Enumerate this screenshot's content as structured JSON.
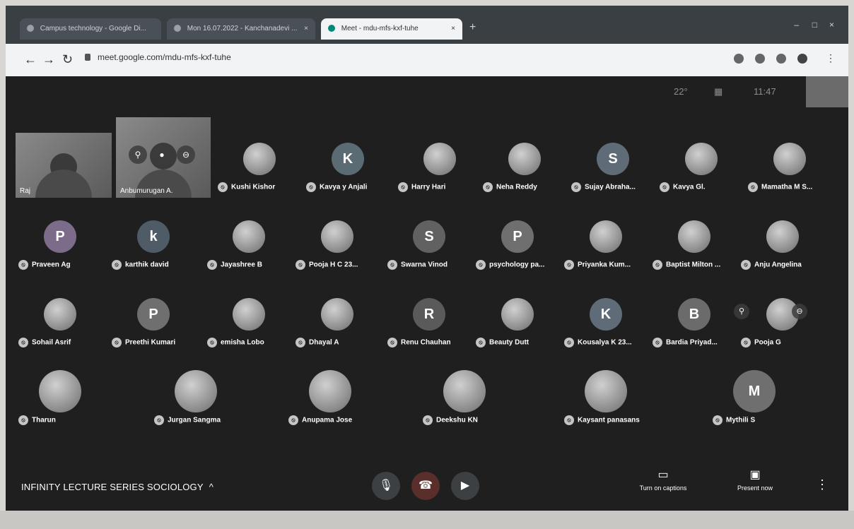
{
  "browser": {
    "tabs": [
      {
        "label": "Campus technology - Google Di...",
        "active": false
      },
      {
        "label": "Mon 16.07.2022 - Kanchanadevi ...",
        "active": false
      },
      {
        "label": "Meet - mdu-mfs-kxf-tuhe",
        "active": true
      }
    ],
    "url": "meet.google.com/mdu-mfs-kxf-tuhe",
    "new_tab": "+"
  },
  "meet": {
    "top_status": {
      "temp": "22°",
      "people_icon": "people-icon",
      "time": "11:47"
    },
    "video_tiles": [
      {
        "name": "Raj",
        "color": "#6e6e6e"
      },
      {
        "name": "Anbumurugan A.",
        "color": "#5b5b5b"
      }
    ],
    "participants": [
      {
        "name": "Kushi Kishor",
        "avatar": "photo",
        "initial": "",
        "color": "#888"
      },
      {
        "name": "Kavya y Anjali",
        "avatar": "letter",
        "initial": "K",
        "color": "#5b6b73"
      },
      {
        "name": "Harry Hari",
        "avatar": "photo",
        "initial": "",
        "color": "#777"
      },
      {
        "name": "Neha Reddy",
        "avatar": "photo",
        "initial": "",
        "color": "#888"
      },
      {
        "name": "Sujay Abraha...",
        "avatar": "letter",
        "initial": "S",
        "color": "#5f6c77"
      },
      {
        "name": "Kavya Gl.",
        "avatar": "photo",
        "initial": "",
        "color": "#888"
      },
      {
        "name": "Mamatha M S...",
        "avatar": "photo",
        "initial": "",
        "color": "#777"
      },
      {
        "name": "Praveen Ag",
        "avatar": "letter",
        "initial": "P",
        "color": "#7d6b8a"
      },
      {
        "name": "karthik david",
        "avatar": "letter",
        "initial": "k",
        "color": "#4f5b66"
      },
      {
        "name": "Jayashree B",
        "avatar": "photo",
        "initial": "",
        "color": "#777"
      },
      {
        "name": "Pooja H C 23...",
        "avatar": "photo",
        "initial": "",
        "color": "#888"
      },
      {
        "name": "Swarna Vinod",
        "avatar": "letter",
        "initial": "S",
        "color": "#616161"
      },
      {
        "name": "psychology pa...",
        "avatar": "letter",
        "initial": "P",
        "color": "#6f6f6f"
      },
      {
        "name": "Priyanka Kum...",
        "avatar": "photo",
        "initial": "",
        "color": "#777"
      },
      {
        "name": "Baptist Milton ...",
        "avatar": "photo",
        "initial": "",
        "color": "#888"
      },
      {
        "name": "Anju Angelina",
        "avatar": "photo",
        "initial": "",
        "color": "#777"
      },
      {
        "name": "Sohail Asrif",
        "avatar": "photo",
        "initial": "",
        "color": "#888"
      },
      {
        "name": "Preethi Kumari",
        "avatar": "letter",
        "initial": "P",
        "color": "#6f6f6f"
      },
      {
        "name": "emisha Lobo",
        "avatar": "photo",
        "initial": "",
        "color": "#888"
      },
      {
        "name": "Dhayal A",
        "avatar": "photo",
        "initial": "",
        "color": "#777"
      },
      {
        "name": "Renu Chauhan",
        "avatar": "letter",
        "initial": "R",
        "color": "#5a5a5a"
      },
      {
        "name": "Beauty Dutt",
        "avatar": "photo",
        "initial": "",
        "color": "#888"
      },
      {
        "name": "Kousalya K 23...",
        "avatar": "letter",
        "initial": "K",
        "color": "#5f6c77"
      },
      {
        "name": "Bardia Priyad...",
        "avatar": "letter",
        "initial": "B",
        "color": "#6b6b6b"
      },
      {
        "name": "Pooja G",
        "avatar": "photo",
        "initial": "",
        "color": "#777"
      },
      {
        "name": "Tharun",
        "avatar": "photo",
        "initial": "",
        "color": "#888"
      },
      {
        "name": "Jurgan Sangma",
        "avatar": "photo",
        "initial": "",
        "color": "#777"
      },
      {
        "name": "Anupama Jose",
        "avatar": "photo",
        "initial": "",
        "color": "#888"
      },
      {
        "name": "Deekshu KN",
        "avatar": "photo",
        "initial": "",
        "color": "#777"
      },
      {
        "name": "Kaysant panasans",
        "avatar": "photo",
        "initial": "",
        "color": "#888"
      },
      {
        "name": "Mythili S",
        "avatar": "letter",
        "initial": "M",
        "color": "#6f6f6f"
      }
    ],
    "meeting_name": "INFINITY LECTURE SERIES SOCIOLOGY",
    "caret": "^",
    "controls": {
      "mic": "🎙",
      "leave": "☎",
      "camera": "▶"
    },
    "right_controls": [
      {
        "label": "Turn on captions",
        "icon": "▭"
      },
      {
        "label": "Present now",
        "icon": "▣"
      }
    ],
    "more": "⋮"
  }
}
